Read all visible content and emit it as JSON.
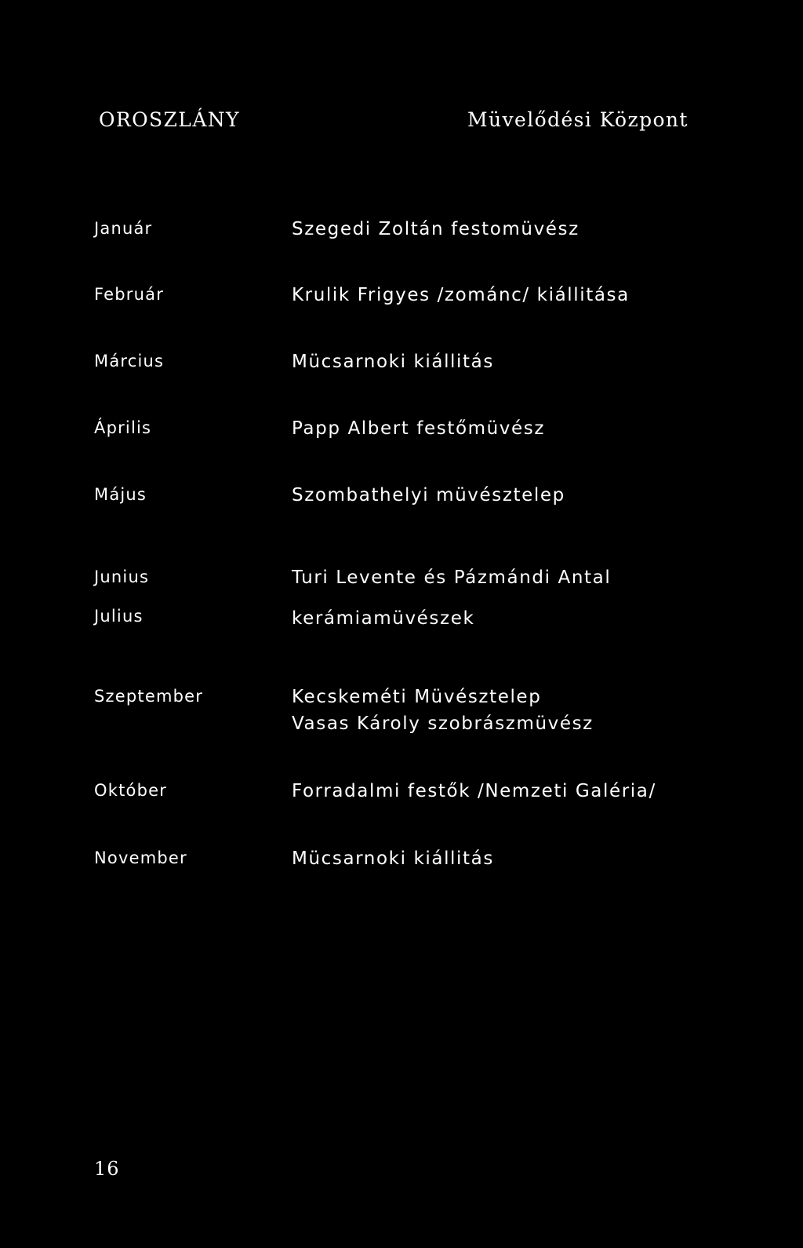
{
  "page": {
    "background_color": "#000000",
    "text_color": "#ffffff",
    "page_number": "16"
  },
  "header": {
    "place": "OROSZLÁNY",
    "venue": "Müvelődési Központ"
  },
  "program": {
    "entries": [
      {
        "month": "Január",
        "lines": [
          "Szegedi Zoltán festomüvész"
        ]
      },
      {
        "month": "Február",
        "lines": [
          "Krulik Frigyes /zománc/ kiállitása"
        ]
      },
      {
        "month": "Március",
        "lines": [
          "Mücsarnoki kiállitás"
        ]
      },
      {
        "month": "Április",
        "lines": [
          "Papp Albert festőmüvész"
        ]
      },
      {
        "month": "Május",
        "lines": [
          "Szombathelyi müvésztelep"
        ]
      },
      {
        "month": "Junius",
        "lines": [
          "Turi Levente és Pázmándi Antal"
        ]
      },
      {
        "month": "Julius",
        "lines": [
          "kerámiamüvészek"
        ]
      },
      {
        "month": "Szeptember",
        "lines": [
          "Kecskeméti  Müvésztelep",
          "Vasas Károly szobrászmüvész"
        ]
      },
      {
        "month": "Október",
        "lines": [
          "Forradalmi festők /Nemzeti Galéria/"
        ]
      },
      {
        "month": "November",
        "lines": [
          "Mücsarnoki kiállitás"
        ]
      }
    ]
  }
}
